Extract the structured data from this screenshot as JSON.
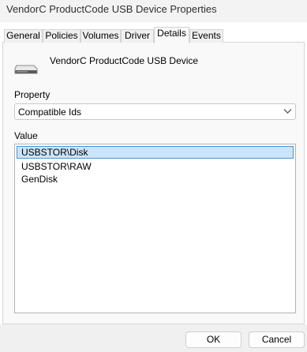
{
  "window": {
    "title": "VendorC ProductCode USB Device Properties"
  },
  "tabs": [
    {
      "label": "General",
      "active": false
    },
    {
      "label": "Policies",
      "active": false
    },
    {
      "label": "Volumes",
      "active": false
    },
    {
      "label": "Driver",
      "active": false
    },
    {
      "label": "Details",
      "active": true
    },
    {
      "label": "Events",
      "active": false
    }
  ],
  "device": {
    "name": "VendorC ProductCode USB Device",
    "icon": "usb-drive-icon"
  },
  "property": {
    "label": "Property",
    "selected": "Compatible Ids"
  },
  "value": {
    "label": "Value",
    "items": [
      "USBSTOR\\Disk",
      "USBSTOR\\RAW",
      "GenDisk"
    ],
    "selected_index": 0
  },
  "buttons": {
    "ok": "OK",
    "cancel": "Cancel"
  },
  "colors": {
    "selection_fill": "#cce4f7",
    "selection_border": "#4a93d6",
    "panel": "#f9f9f9",
    "footer": "#f0f0f0"
  }
}
